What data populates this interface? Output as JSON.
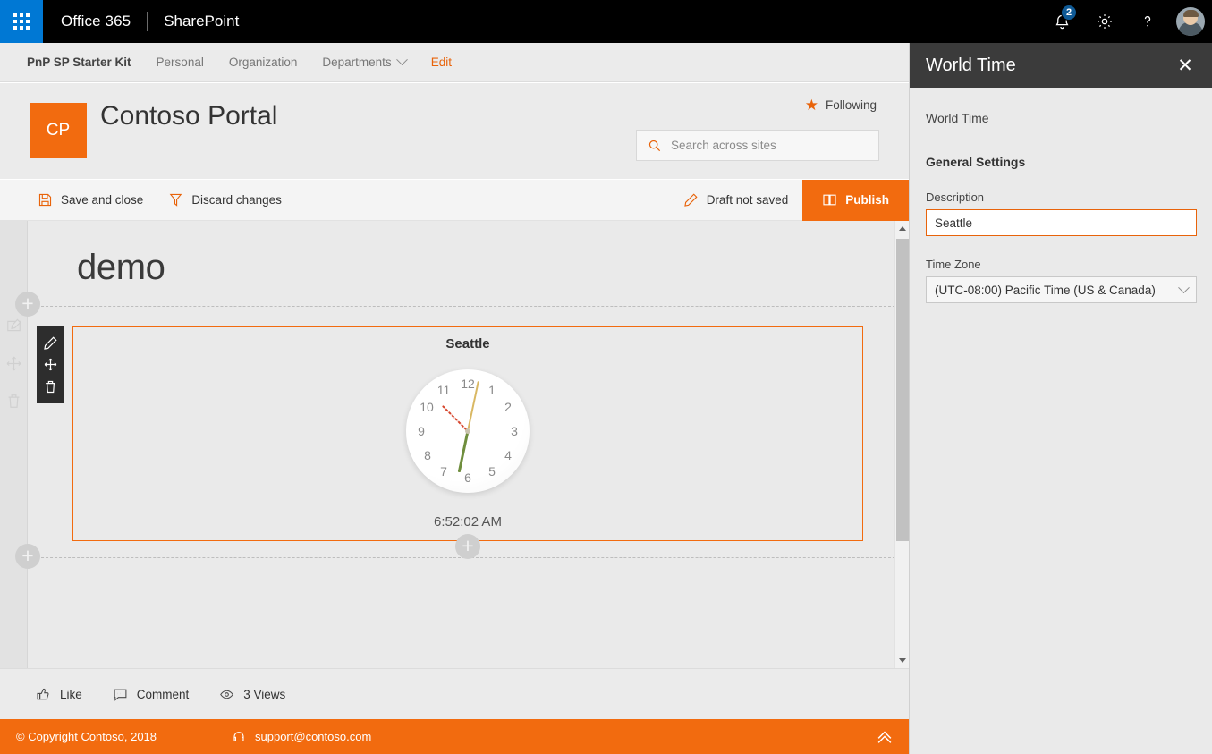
{
  "suite": {
    "waffle_label": "app-launcher",
    "brand": "Office 365",
    "app": "SharePoint",
    "notification_count": "2",
    "icons": [
      "bell-icon",
      "gear-icon",
      "help-icon",
      "avatar"
    ]
  },
  "nav": {
    "items": [
      {
        "label": "PnP SP Starter Kit",
        "style": "home"
      },
      {
        "label": "Personal",
        "style": "normal"
      },
      {
        "label": "Organization",
        "style": "normal"
      },
      {
        "label": "Departments",
        "style": "dropdown"
      },
      {
        "label": "Edit",
        "style": "edit"
      }
    ]
  },
  "site": {
    "logo_initials": "CP",
    "title": "Contoso Portal",
    "following_label": "Following",
    "search_placeholder": "Search across sites"
  },
  "command_bar": {
    "save_label": "Save and close",
    "discard_label": "Discard changes",
    "draft_status": "Draft not saved",
    "publish_label": "Publish"
  },
  "canvas": {
    "page_title": "demo",
    "webpart_tools": [
      "edit-pencil-icon",
      "move-icon",
      "delete-trash-icon"
    ],
    "gutter_ghost_tools": [
      "edit-pencil-icon",
      "move-icon",
      "delete-trash-icon"
    ],
    "add_button_label": "+"
  },
  "webpart": {
    "city": "Seattle",
    "time": "6:52:02 AM",
    "clock": {
      "numbers": [
        "12",
        "1",
        "2",
        "3",
        "4",
        "5",
        "6",
        "7",
        "8",
        "9",
        "10",
        "11"
      ],
      "hour_angle": -45,
      "minute_angle": 12,
      "second_angle": 192,
      "hour_hand_color": "#d6432a",
      "minute_hand_color": "#d9b863",
      "second_hand_color": "#6f8e3d"
    }
  },
  "social": {
    "like_label": "Like",
    "comment_label": "Comment",
    "views_label": "3 Views"
  },
  "footer": {
    "copyright": "© Copyright Contoso, 2018",
    "support_email": "support@contoso.com",
    "scroll_top_icon": "chevron-double-up-icon"
  },
  "panel": {
    "title": "World Time",
    "close_label": "✕",
    "subtitle": "World Time",
    "section_heading": "General Settings",
    "description_label": "Description",
    "description_value": "Seattle",
    "timezone_label": "Time Zone",
    "timezone_value": "(UTC-08:00) Pacific Time (US & Canada)"
  },
  "colors": {
    "accent_orange": "#f26b0f",
    "suite_blue": "#0078d4",
    "panel_header": "#3b3b3b",
    "canvas_bg": "#eaeaea"
  }
}
